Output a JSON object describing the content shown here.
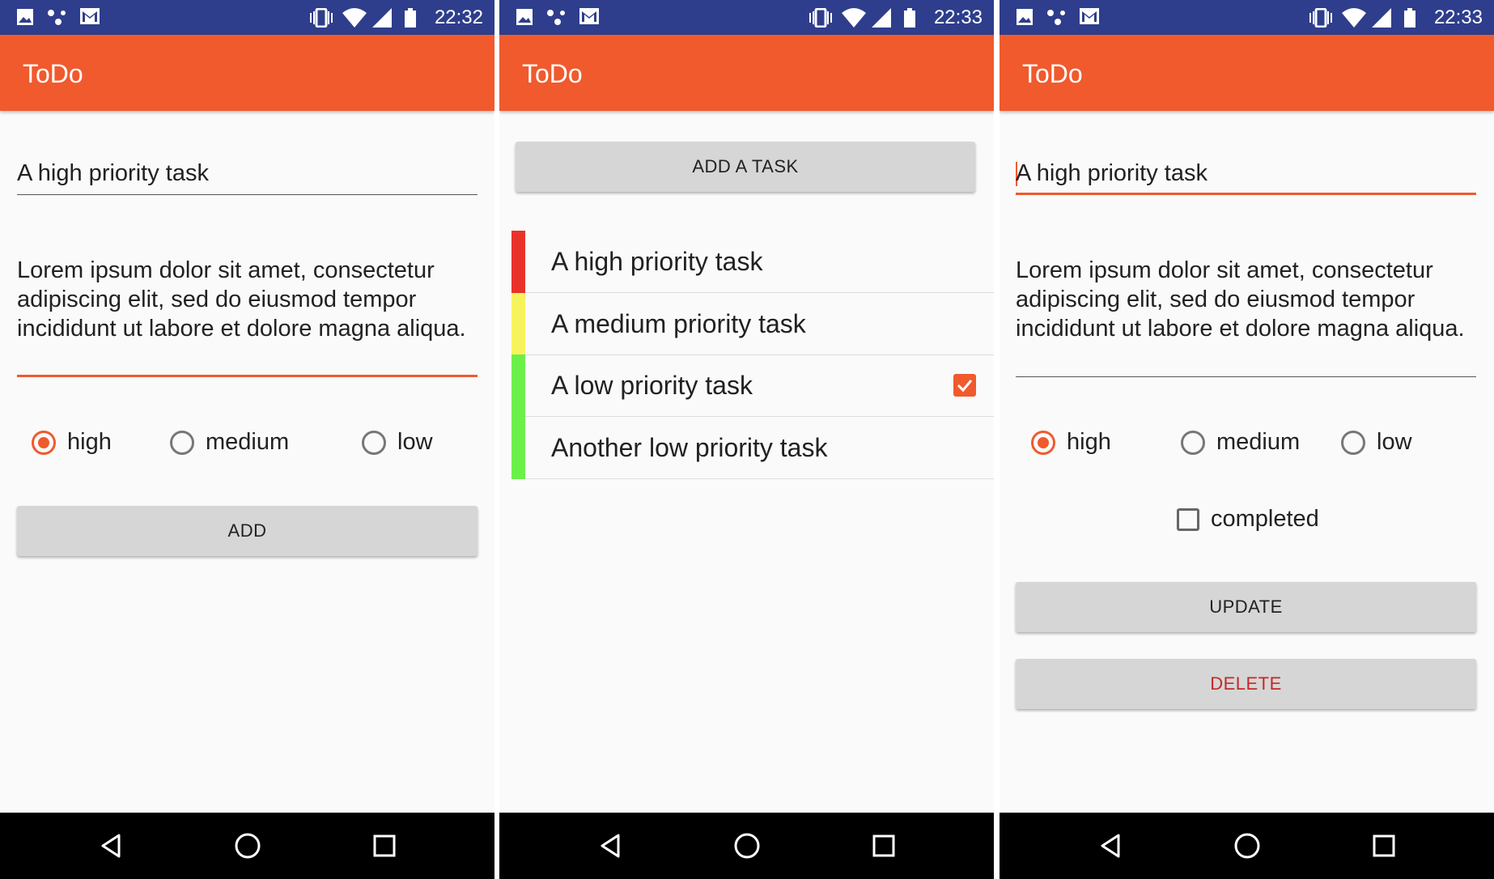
{
  "colors": {
    "status_bar": "#2e3e8c",
    "app_bar": "#f05a2d",
    "accent": "#f05a2d",
    "priority_high": "#e8332a",
    "priority_medium": "#f7f35d",
    "priority_low": "#6bf04a"
  },
  "status_bar_icons": [
    "image-icon",
    "dots-icon",
    "gmail-icon",
    "vibrate-icon",
    "wifi-icon",
    "signal-icon",
    "battery-icon"
  ],
  "screens": [
    {
      "time": "22:32",
      "title": "ToDo",
      "title_field": "A high priority task",
      "description_field": "Lorem ipsum dolor sit amet, consectetur adipiscing elit, sed do eiusmod tempor incididunt ut labore et dolore magna aliqua.",
      "priority_options": [
        "high",
        "medium",
        "low"
      ],
      "selected_priority": "high",
      "button": "ADD"
    },
    {
      "time": "22:33",
      "title": "ToDo",
      "button": "ADD A TASK",
      "tasks": [
        {
          "label": "A high priority task",
          "priority": "high",
          "completed": false
        },
        {
          "label": "A medium priority task",
          "priority": "medium",
          "completed": false
        },
        {
          "label": "A low priority task",
          "priority": "low",
          "completed": true
        },
        {
          "label": "Another low priority task",
          "priority": "low",
          "completed": false
        }
      ]
    },
    {
      "time": "22:33",
      "title": "ToDo",
      "title_field": "A high priority task",
      "description_field": "Lorem ipsum dolor sit amet, consectetur adipiscing elit, sed do eiusmod tempor incididunt ut labore et dolore magna aliqua.",
      "priority_options": [
        "high",
        "medium",
        "low"
      ],
      "selected_priority": "high",
      "completed_label": "completed",
      "completed": false,
      "update_button": "UPDATE",
      "delete_button": "DELETE"
    }
  ],
  "nav_icons": [
    "back-icon",
    "home-icon",
    "recents-icon"
  ]
}
